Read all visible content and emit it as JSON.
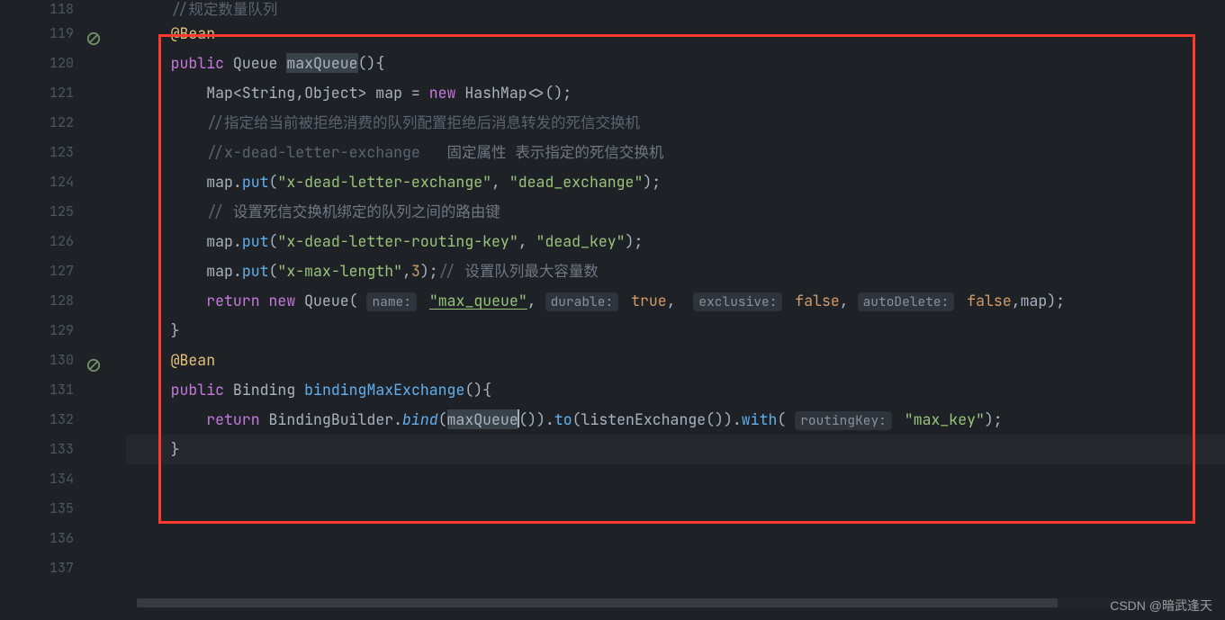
{
  "gutter": {
    "line_numbers": [
      "118",
      "119",
      "120",
      "121",
      "122",
      "123",
      "124",
      "125",
      "126",
      "127",
      "128",
      "129",
      "130",
      "131",
      "132",
      "133",
      "134",
      "135",
      "136",
      "137"
    ],
    "icon_lines": [
      119,
      130
    ],
    "icon_name": "no-entry-icon"
  },
  "code": {
    "l117": {
      "comment": "//规定数量队列"
    },
    "l118": {
      "anno": "@Bean"
    },
    "l119": {
      "kw_public": "public",
      "type": "Queue",
      "method": "maxQueue",
      "paren": "(){"
    },
    "l120": {
      "pre": "        ",
      "t1": "Map<String,Object> map ",
      "eq": "= ",
      "kw_new": "new",
      "t2": " HashMap<>();"
    },
    "l121": {
      "pre": "        ",
      "comment": "//指定给当前被拒绝消费的队列配置拒绝后消息转发的死信交换机"
    },
    "l122": {
      "pre": "        ",
      "c1": "//x-dead-letter-exchange   ",
      "c2": "固定属性 表示指定的死信交换机"
    },
    "l123": {
      "pre": "        ",
      "t1": "map.",
      "m": "put",
      "t2": "(",
      "s1": "\"x-dead-letter-exchange\"",
      "t3": ", ",
      "s2": "\"dead_exchange\"",
      "t4": ");"
    },
    "l124": {
      "pre": "        ",
      "c1": "// ",
      "c2": "设置死信交换机绑定的队列之间的路由键"
    },
    "l125": {
      "pre": "        ",
      "t1": "map.",
      "m": "put",
      "t2": "(",
      "s1": "\"x-dead-letter-routing-key\"",
      "t3": ", ",
      "s2": "\"dead_key\"",
      "t4": ");"
    },
    "l126": {
      "pre": "        ",
      "t1": "map.",
      "m": "put",
      "t2": "(",
      "s1": "\"x-max-length\"",
      "t3": ",",
      "n": "3",
      "t4": ");",
      "c": "// ",
      "c2": "设置队列最大容量数"
    },
    "l127": {
      "pre": "        ",
      "kw_return": "return",
      "sp": " ",
      "kw_new": "new",
      "sp2": " ",
      "type": "Queue",
      "t1": "( ",
      "h1": "name:",
      "sp3": " ",
      "s1": "\"max_queue\"",
      "t2": ", ",
      "h2": "durable:",
      "sp4": " ",
      "b1": "true",
      "t3": ",  ",
      "h3": "exclusive:",
      "sp5": " ",
      "b2": "false",
      "t4": ", ",
      "h4": "autoDelete:",
      "sp6": " ",
      "b3": "false",
      "t5": ",map);"
    },
    "l128": {
      "brace": "}"
    },
    "l129": {
      "anno": "@Bean"
    },
    "l130": {
      "kw_public": "public",
      "sp": " ",
      "type": "Binding",
      "sp2": " ",
      "method": "bindingMaxExchange",
      "paren": "(){"
    },
    "l131": {
      "pre": "        ",
      "kw_return": "return",
      "sp": " ",
      "t1": "BindingBuilder.",
      "m1": "bind",
      "t2": "(",
      "sel": "maxQueue",
      "t3": "()).",
      "m2": "to",
      "t4": "(listenExchange()).",
      "m3": "with",
      "t5": "( ",
      "h1": "routingKey:",
      "sp2": " ",
      "s1": "\"max_key\"",
      "t6": ");"
    },
    "l132": {
      "brace": "}"
    }
  },
  "highlight_line_index": 14,
  "watermark": "CSDN @暗武逢天"
}
